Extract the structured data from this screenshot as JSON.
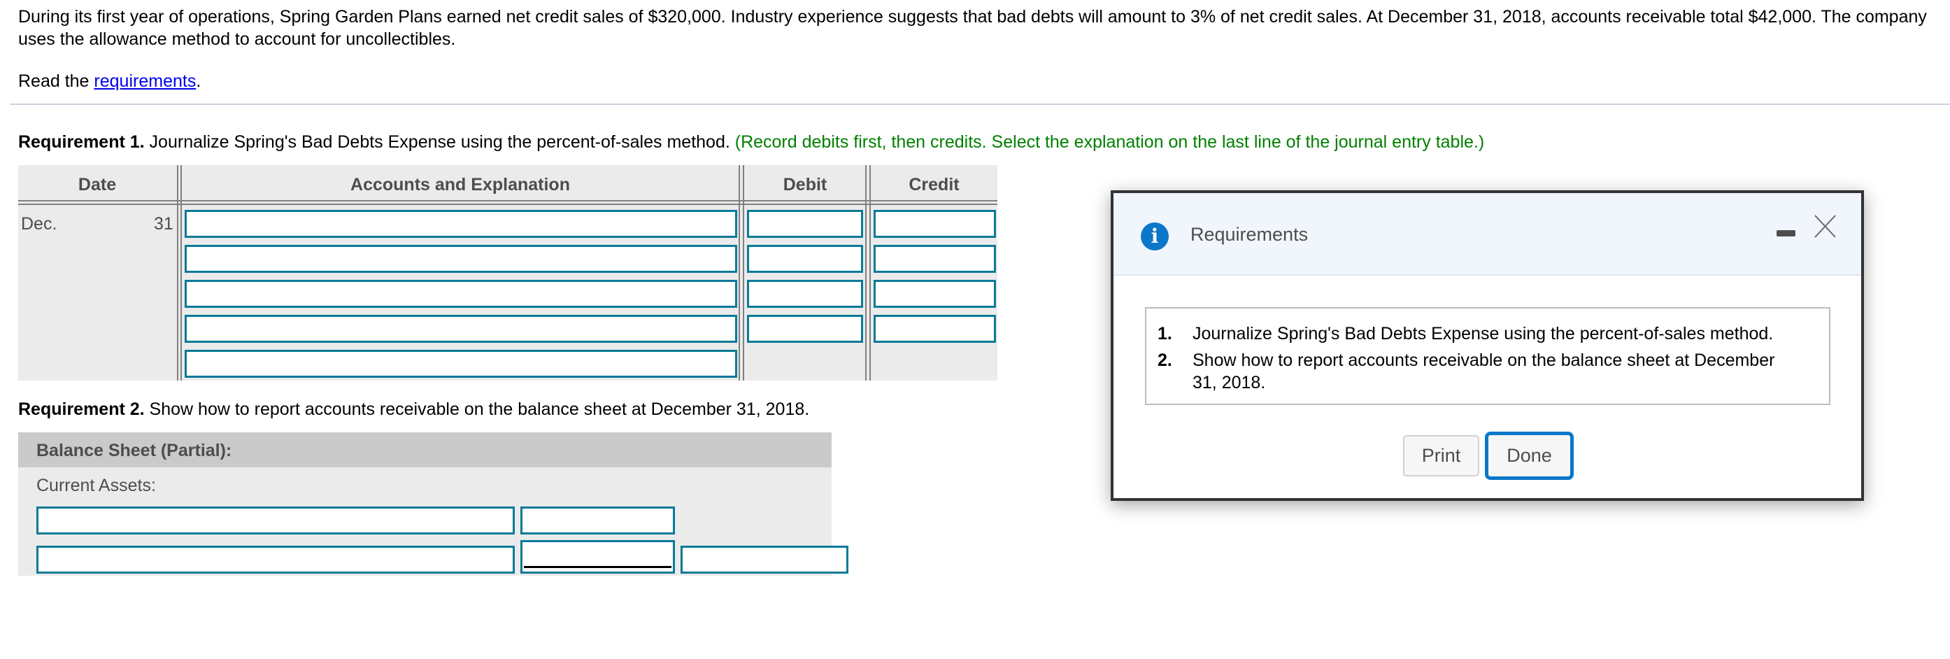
{
  "problem": {
    "intro": "During its first year of operations, Spring Garden Plans earned net credit sales of $320,000. Industry experience suggests that bad debts will amount to 3% of net credit sales. At December 31, 2018, accounts receivable total $42,000. The company uses the allowance method to account for uncollectibles.",
    "read_prefix": "Read the ",
    "read_link": "requirements",
    "read_suffix": "."
  },
  "requirement1": {
    "label": "Requirement 1.",
    "text": " Journalize Spring's Bad Debts Expense using the percent-of-sales method. ",
    "instruction": "(Record debits first, then credits. Select the explanation on the last line of the journal entry table.)"
  },
  "journal": {
    "headers": {
      "date": "Date",
      "accounts": "Accounts and Explanation",
      "debit": "Debit",
      "credit": "Credit"
    },
    "date_month": "Dec.",
    "date_day": "31",
    "rows": [
      {
        "account": "",
        "debit": "",
        "credit": ""
      },
      {
        "account": "",
        "debit": "",
        "credit": ""
      },
      {
        "account": "",
        "debit": "",
        "credit": ""
      },
      {
        "account": "",
        "debit": "",
        "credit": ""
      },
      {
        "account": ""
      }
    ]
  },
  "requirement2": {
    "label": "Requirement 2.",
    "text": " Show how to report accounts receivable on the balance sheet at December 31, 2018."
  },
  "balance_sheet": {
    "title": "Balance Sheet (Partial):",
    "subtitle": "Current Assets:",
    "rows": [
      {
        "label": "",
        "amount": ""
      },
      {
        "label": "",
        "amount": "",
        "total": ""
      }
    ]
  },
  "modal": {
    "title": "Requirements",
    "icon": "info-icon",
    "items": [
      {
        "num": "1.",
        "text": "Journalize Spring's Bad Debts Expense using the percent-of-sales method."
      },
      {
        "num": "2.",
        "text": "Show how to report accounts receivable on the balance sheet at December 31, 2018."
      }
    ],
    "print_label": "Print",
    "done_label": "Done"
  },
  "colors": {
    "input_border": "#0a7a98",
    "accent_blue": "#0a77c9",
    "instruction_green": "#008000",
    "link_blue": "#0000ee"
  }
}
